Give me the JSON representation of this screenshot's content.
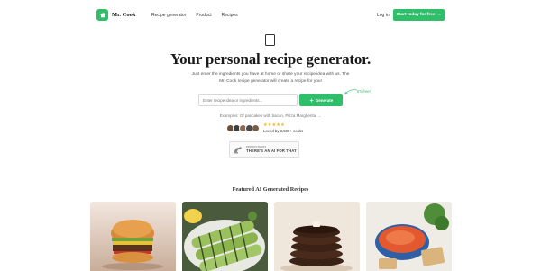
{
  "nav": {
    "brand": "Mr. Cook",
    "links": [
      "Recipe generator",
      "Product",
      "Recipes"
    ],
    "login": "Log in",
    "cta": "Start today for free",
    "cta_arrow": "→"
  },
  "hero": {
    "title": "Your personal recipe generator.",
    "subtitle": "Just enter the ingredients you have at home or share your recipe idea with us. The Mr. Cook recipe generator will create a recipe for you!",
    "search_placeholder": "Enter recipe idea or ingredients...",
    "generate_label": "Generate",
    "free_note": "It's free!",
    "examples": "Examples: Gf pancakes with bacon, Pizza Margherita, ..."
  },
  "social_proof": {
    "stars": "★★★★★",
    "rating": 5,
    "loved_by": "Loved by 3,500+ cooks",
    "avatar_colors": [
      "#6b4f3a",
      "#3d3d3d",
      "#8a6a52",
      "#4a4a4a",
      "#7b5b44"
    ]
  },
  "badge": {
    "small": "PRODUCTHUNT",
    "big": "THERE'S AN AI FOR THAT"
  },
  "featured": {
    "heading": "Featured AI Generated Recipes",
    "cards": [
      {
        "name": "burger"
      },
      {
        "name": "grilled-zucchini"
      },
      {
        "name": "chocolate-pancakes"
      },
      {
        "name": "tomato-dip"
      }
    ]
  },
  "colors": {
    "accent": "#2fbe6a",
    "star": "#f5b301"
  }
}
